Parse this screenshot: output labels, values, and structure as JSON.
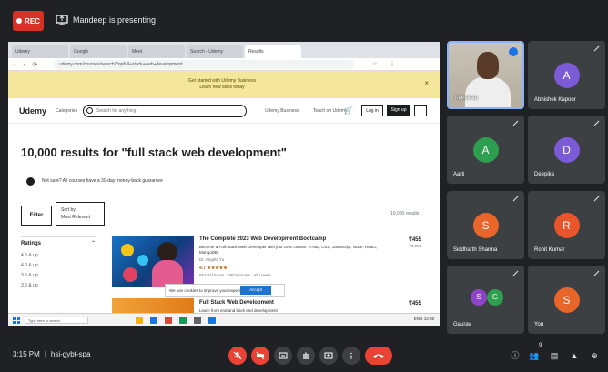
{
  "topbar": {
    "rec_label": "REC",
    "presenting_label": "Mandeep is presenting"
  },
  "shared_screen": {
    "browser_tabs": [
      "Udemy",
      "Google",
      "Meet",
      "Search - Udemy",
      "Results"
    ],
    "url": "udemy.com/courses/search/?q=full+stack+web+development",
    "banner_lines": [
      "Get started with Udemy Business",
      "Learn new skills today"
    ],
    "site": {
      "logo": "Udemy",
      "categories_label": "Categories",
      "search_placeholder": "Search for anything",
      "nav_links": [
        "Udemy Business",
        "Teach on Udemy"
      ],
      "login_label": "Log in",
      "signup_label": "Sign up"
    },
    "results_heading": "10,000 results for \"full stack web development\"",
    "promo_text": "Not sure? All courses have a 30-day money-back guarantee",
    "filter_label": "Filter",
    "sort_label": "Sort by",
    "sort_value": "Most Relevant",
    "results_count_label": "10,000 results",
    "sidebar": {
      "rating_heading": "Ratings",
      "options": [
        "4.5 & up",
        "4.0 & up",
        "3.5 & up",
        "3.0 & up"
      ]
    },
    "courses": [
      {
        "title": "The Complete 2023 Web Development Bootcamp",
        "desc": "Become a Full-Stack Web Developer with just ONE course. HTML, CSS, Javascript, Node, React, MongoDB",
        "author": "Dr. Angela Yu",
        "rating": "4.7 ★★★★★",
        "meta": "65 total hours · 490 lectures · All Levels",
        "price": "₹455",
        "old_price": "₹3,099"
      },
      {
        "title": "Full Stack Web Development",
        "desc": "Learn front end and back end development",
        "price": "₹455"
      }
    ],
    "cookie_text": "We use cookies to improve your experience",
    "cookie_button": "Accept",
    "taskbar_search": "Type here to search",
    "taskbar_tray": "ENG  12:09"
  },
  "participants": [
    {
      "name": "Mandeep",
      "type": "video"
    },
    {
      "name": "Abhishek Kapoor",
      "initial": "A",
      "color": "#7b5bd6"
    },
    {
      "name": "Aarti",
      "initial": "A",
      "color": "#2e9e4f"
    },
    {
      "name": "Deepika",
      "initial": "D",
      "color": "#7b5bd6"
    },
    {
      "name": "Siddharth Sharma",
      "initial": "S",
      "color": "#e8662a"
    },
    {
      "name": "Rohit Kumar",
      "initial": "R",
      "color": "#e8552a"
    },
    {
      "name": "Gaurav",
      "initial": "G",
      "color": "#2e9e4f",
      "second_initial": "S",
      "second_color": "#8e44c9"
    },
    {
      "name": "You",
      "initial": "S",
      "color": "#e8662a"
    }
  ],
  "bottombar": {
    "time": "3:15 PM",
    "meeting_code": "hsi-gybt-spa",
    "people_count": "9"
  }
}
